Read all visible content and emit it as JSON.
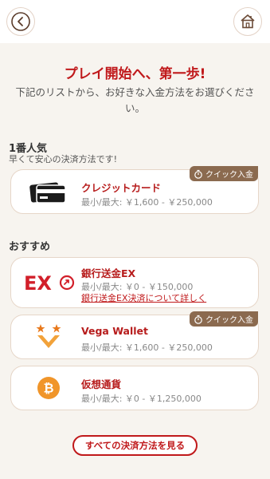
{
  "header": {
    "back_icon": "back-arrow-icon",
    "home_icon": "house-icon"
  },
  "intro": {
    "title": "プレイ開始へ、第一歩!",
    "subtitle": "下記のリストから、お好きな入金方法をお選びください。"
  },
  "popular": {
    "title": "1番人気",
    "subtitle": "早くて安心の決済方法です!",
    "methods": [
      {
        "name": "クレジットカード",
        "limit": "最小/最大: ￥1,600 - ￥250,000",
        "badge": "クイック入金",
        "icon": "credit-card-icon"
      }
    ]
  },
  "recommended": {
    "title": "おすすめ",
    "methods": [
      {
        "name": "銀行送金EX",
        "limit": "最小/最大: ￥0 - ￥150,000",
        "link": "銀行送金EX決済について詳しく",
        "logo_text": "EX",
        "icon": "bank-transfer-ex-icon"
      },
      {
        "name": "Vega Wallet",
        "limit": "最小/最大: ￥1,600 - ￥250,000",
        "badge": "クイック入金",
        "icon": "vega-wallet-icon"
      },
      {
        "name": "仮想通貨",
        "limit": "最小/最大: ￥0 - ￥1,250,000",
        "icon": "bitcoin-icon"
      }
    ]
  },
  "footer": {
    "see_all": "すべての決済方法を見る"
  },
  "colors": {
    "accent": "#c0191b",
    "badge": "#8b6a4f",
    "background": "#f7f4ef"
  }
}
